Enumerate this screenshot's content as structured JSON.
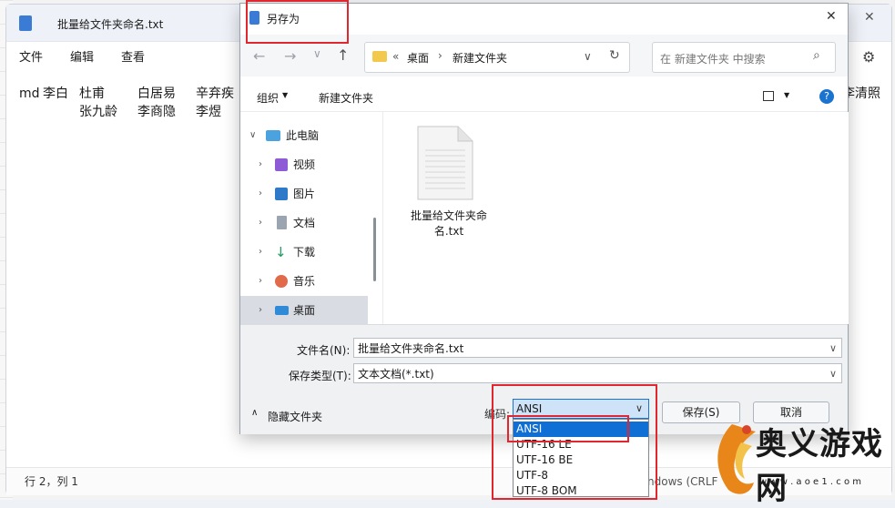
{
  "notepad": {
    "title": "批量给文件夹命名.txt",
    "menu": [
      "文件",
      "编辑",
      "查看"
    ],
    "lines": [
      [
        "md",
        "李白",
        "杜甫",
        "白居易",
        "辛弃疾"
      ],
      [
        "",
        "",
        "张九龄",
        "李商隐",
        "李煜"
      ]
    ],
    "right_snippet": "李清照",
    "status": "行 2，列 1",
    "status_right": "ndows (CRLF"
  },
  "dialog": {
    "title": "另存为",
    "close_label": "✕",
    "breadcrumb": [
      "«",
      "桌面",
      "新建文件夹"
    ],
    "search_placeholder": "在 新建文件夹 中搜索",
    "organize": "组织",
    "new_folder": "新建文件夹",
    "help": "?",
    "tree": [
      {
        "label": "此电脑",
        "icon": "computer-icon",
        "expanded": true,
        "indent": 0
      },
      {
        "label": "视频",
        "icon": "video-icon",
        "indent": 1
      },
      {
        "label": "图片",
        "icon": "image-icon",
        "indent": 1
      },
      {
        "label": "文档",
        "icon": "document-icon",
        "indent": 1
      },
      {
        "label": "下载",
        "icon": "download-icon",
        "indent": 1
      },
      {
        "label": "音乐",
        "icon": "music-icon",
        "indent": 1
      },
      {
        "label": "桌面",
        "icon": "desktop-icon",
        "indent": 1,
        "selected": true
      }
    ],
    "file": {
      "name": "批量给文件夹命名.txt",
      "icon": "text-file-icon"
    },
    "filename_label": "文件名(N):",
    "filename_value": "批量给文件夹命名.txt",
    "filetype_label": "保存类型(T):",
    "filetype_value": "文本文档(*.txt)",
    "hide_folders": "隐藏文件夹",
    "encoding_label": "编码:",
    "encoding_value": "ANSI",
    "encoding_options": [
      "ANSI",
      "UTF-16 LE",
      "UTF-16 BE",
      "UTF-8",
      "UTF-8 BOM"
    ],
    "save_button": "保存(S)",
    "cancel_button": "取消"
  },
  "watermark": {
    "brand": "奥义游戏网",
    "url": "w w w . a o e 1 . c o m"
  },
  "colors": {
    "highlight_red": "#e0262f",
    "selection_blue": "#0f6fd5",
    "help_blue": "#1a73d1"
  }
}
